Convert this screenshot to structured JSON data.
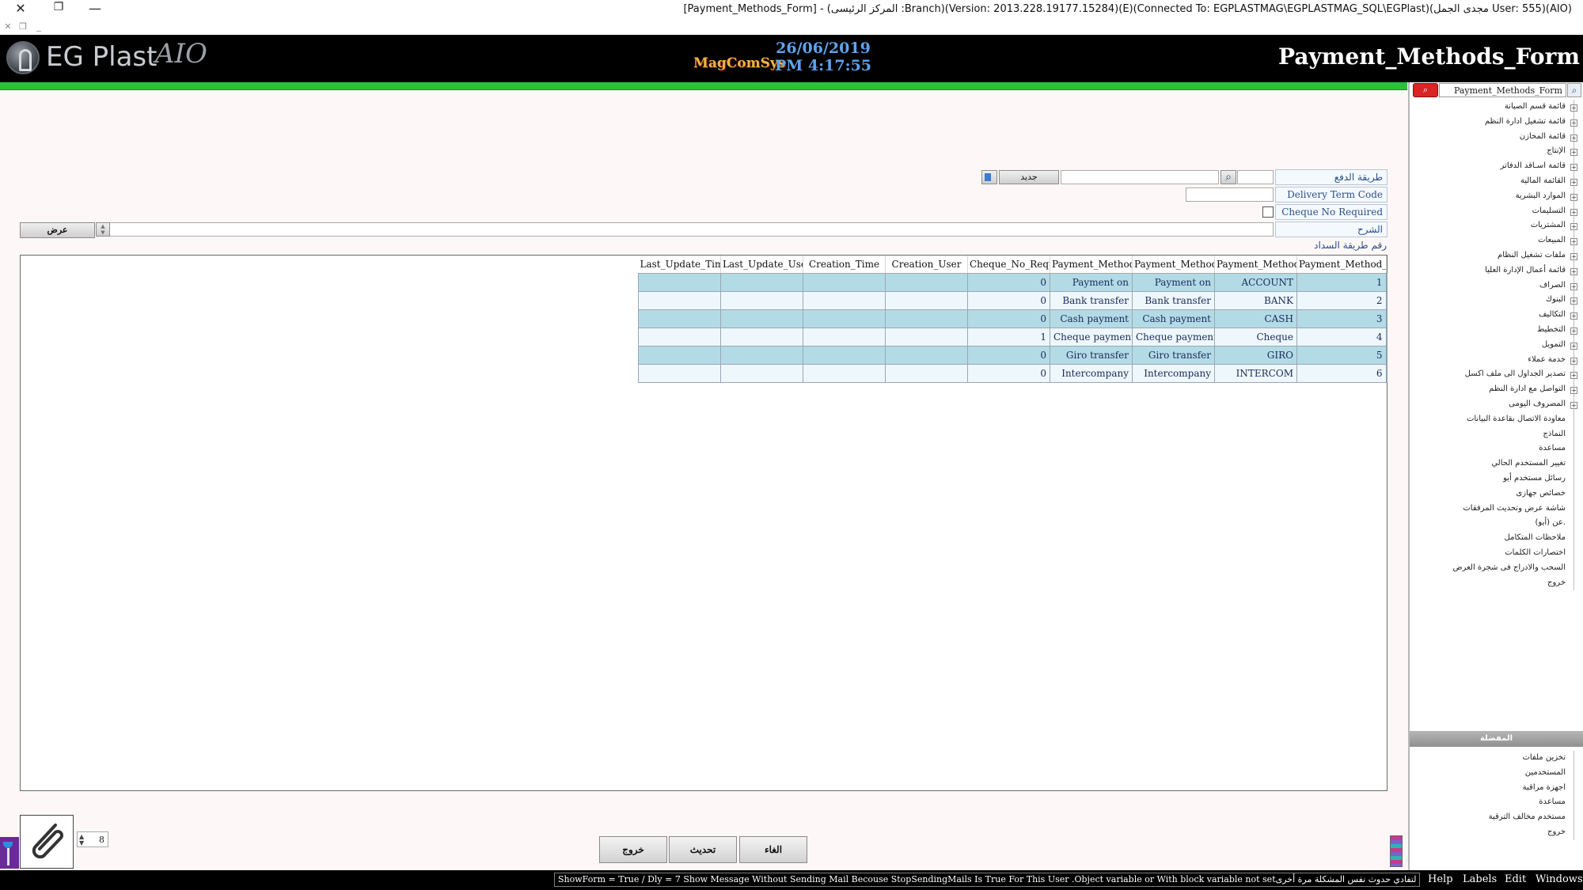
{
  "window": {
    "title": "[Payment_Methods_Form] - (المركز الرئيسى :Branch)(Version: 2013.228.19177.15284)(E)(Connected To: EGPLASTMAG\\EGPLASTMAG_SQL\\EGPlast)(مجدى الجمل User: 555)(AIO)",
    "close_glyph": "✕",
    "restore_glyph": "❐",
    "minimize_glyph": "—",
    "mdi_close": "✕",
    "mdi_restore": "❐",
    "mdi_min": "_"
  },
  "header": {
    "logo_text": "EG Plast",
    "logo_suffix": "AIO",
    "brand": "MagComSys",
    "date": "26/06/2019",
    "time": "PM 4:17:55",
    "form_title": "Payment_Methods_Form"
  },
  "form": {
    "payment_method_label": "طريقة الدفع",
    "new_button": "جديد",
    "delivery_term_label": "Delivery Term Code",
    "cheque_required_label": "Cheque No Required",
    "description_label": "الشرح",
    "show_button": "عرض",
    "payment_method_no_caption": "رقم طريقة السداد",
    "search_glyph": "⌕"
  },
  "grid": {
    "columns": [
      "Payment_Method_No",
      "Payment_Method_Code",
      "Payment_Method_Name",
      "Payment_Method_Description",
      "Cheque_No_Required",
      "Creation_User",
      "Creation_Time",
      "Last_Update_User",
      "Last_Update_Time"
    ],
    "rows": [
      [
        "1",
        "ACCOUNT",
        "Payment on",
        "Payment on",
        "0",
        "",
        "",
        "",
        ""
      ],
      [
        "2",
        "BANK",
        "Bank transfer",
        "Bank transfer",
        "0",
        "",
        "",
        "",
        ""
      ],
      [
        "3",
        "CASH",
        "Cash payment",
        "Cash payment",
        "0",
        "",
        "",
        "",
        ""
      ],
      [
        "4",
        "Cheque",
        "Cheque payment",
        "Cheque payment",
        "1",
        "",
        "",
        "",
        ""
      ],
      [
        "5",
        "GIRO",
        "Giro transfer",
        "Giro transfer",
        "0",
        "",
        "",
        "",
        ""
      ],
      [
        "6",
        "INTERCOM",
        "Intercompany",
        "Intercompany",
        "0",
        "",
        "",
        "",
        ""
      ]
    ]
  },
  "bottom": {
    "exit_button": "خروج",
    "refresh_button": "تحديث",
    "cancel_button": "الغاء",
    "page_size": "8"
  },
  "statusbar": {
    "message": "ShowForm = True / Dly = 7 Show Message Without Sending Mail Becouse StopSendingMails Is True For This User .Object variable or With block variable not setمن فضلك أخبر فريق الدعم الفني لأبو بهذا الخطأ لتفادي حدوث نفس المشكلة مرة أخرى",
    "menu": [
      "Help",
      "Labels",
      "Edit",
      "Windows"
    ]
  },
  "tree": {
    "search_value": "Payment_Methods_Form",
    "search_button_glyph": "⌕",
    "items": [
      {
        "label": "قائمة قسم الصيانة",
        "expandable": true
      },
      {
        "label": "قائمة تشغيل ادارة النظم",
        "expandable": true
      },
      {
        "label": "قائمة المخازن",
        "expandable": true
      },
      {
        "label": "الإنتاج",
        "expandable": true
      },
      {
        "label": "قائمة اسـاقد الدفاتر",
        "expandable": true
      },
      {
        "label": "القائمة المالية",
        "expandable": true
      },
      {
        "label": "الموارد البشرية",
        "expandable": true
      },
      {
        "label": "التسليمات",
        "expandable": true
      },
      {
        "label": "المشتريات",
        "expandable": true
      },
      {
        "label": "المبيعات",
        "expandable": true
      },
      {
        "label": "ملفات تشغيل النظام",
        "expandable": true
      },
      {
        "label": "قائمة أعمال الإدارة العليا",
        "expandable": true
      },
      {
        "label": "الصراف",
        "expandable": true
      },
      {
        "label": "البنوك",
        "expandable": true
      },
      {
        "label": "التكاليف",
        "expandable": true
      },
      {
        "label": "التخطيط",
        "expandable": true
      },
      {
        "label": "التمويل",
        "expandable": true
      },
      {
        "label": "خدمة عملاء",
        "expandable": true
      },
      {
        "label": "تصدير الجداول الى ملف اكسل",
        "expandable": true
      },
      {
        "label": "التواصل مع ادارة النظم",
        "expandable": true
      },
      {
        "label": "المصروف اليومى",
        "expandable": true
      },
      {
        "label": "معاودة الاتصال بقاعدة البيانات",
        "expandable": false
      },
      {
        "label": "النماذج",
        "expandable": false
      },
      {
        "label": "مساعدة",
        "expandable": false
      },
      {
        "label": "تغيير المستخدم الحالي",
        "expandable": false
      },
      {
        "label": "رسائل مستخدم أيو",
        "expandable": false
      },
      {
        "label": "خصائص جهازى",
        "expandable": false
      },
      {
        "label": "شاشة عرض وتحديث المرفقات",
        "expandable": false
      },
      {
        "label": "عن (أيو).",
        "expandable": false
      },
      {
        "label": "ملاحظات المتكامل",
        "expandable": false
      },
      {
        "label": "اختصارات الكلمات",
        "expandable": false
      },
      {
        "label": "السحب والادراج فى شجرة العرض",
        "expandable": false
      },
      {
        "label": "خروج",
        "expandable": false
      }
    ],
    "favorites_title": "المفضلة",
    "favorites": [
      "تخزين ملفات",
      "المستخدمين",
      "اجهزة مراقبة",
      "مساعدة",
      "مستخدم مخالف الترقية",
      "خروج"
    ]
  }
}
